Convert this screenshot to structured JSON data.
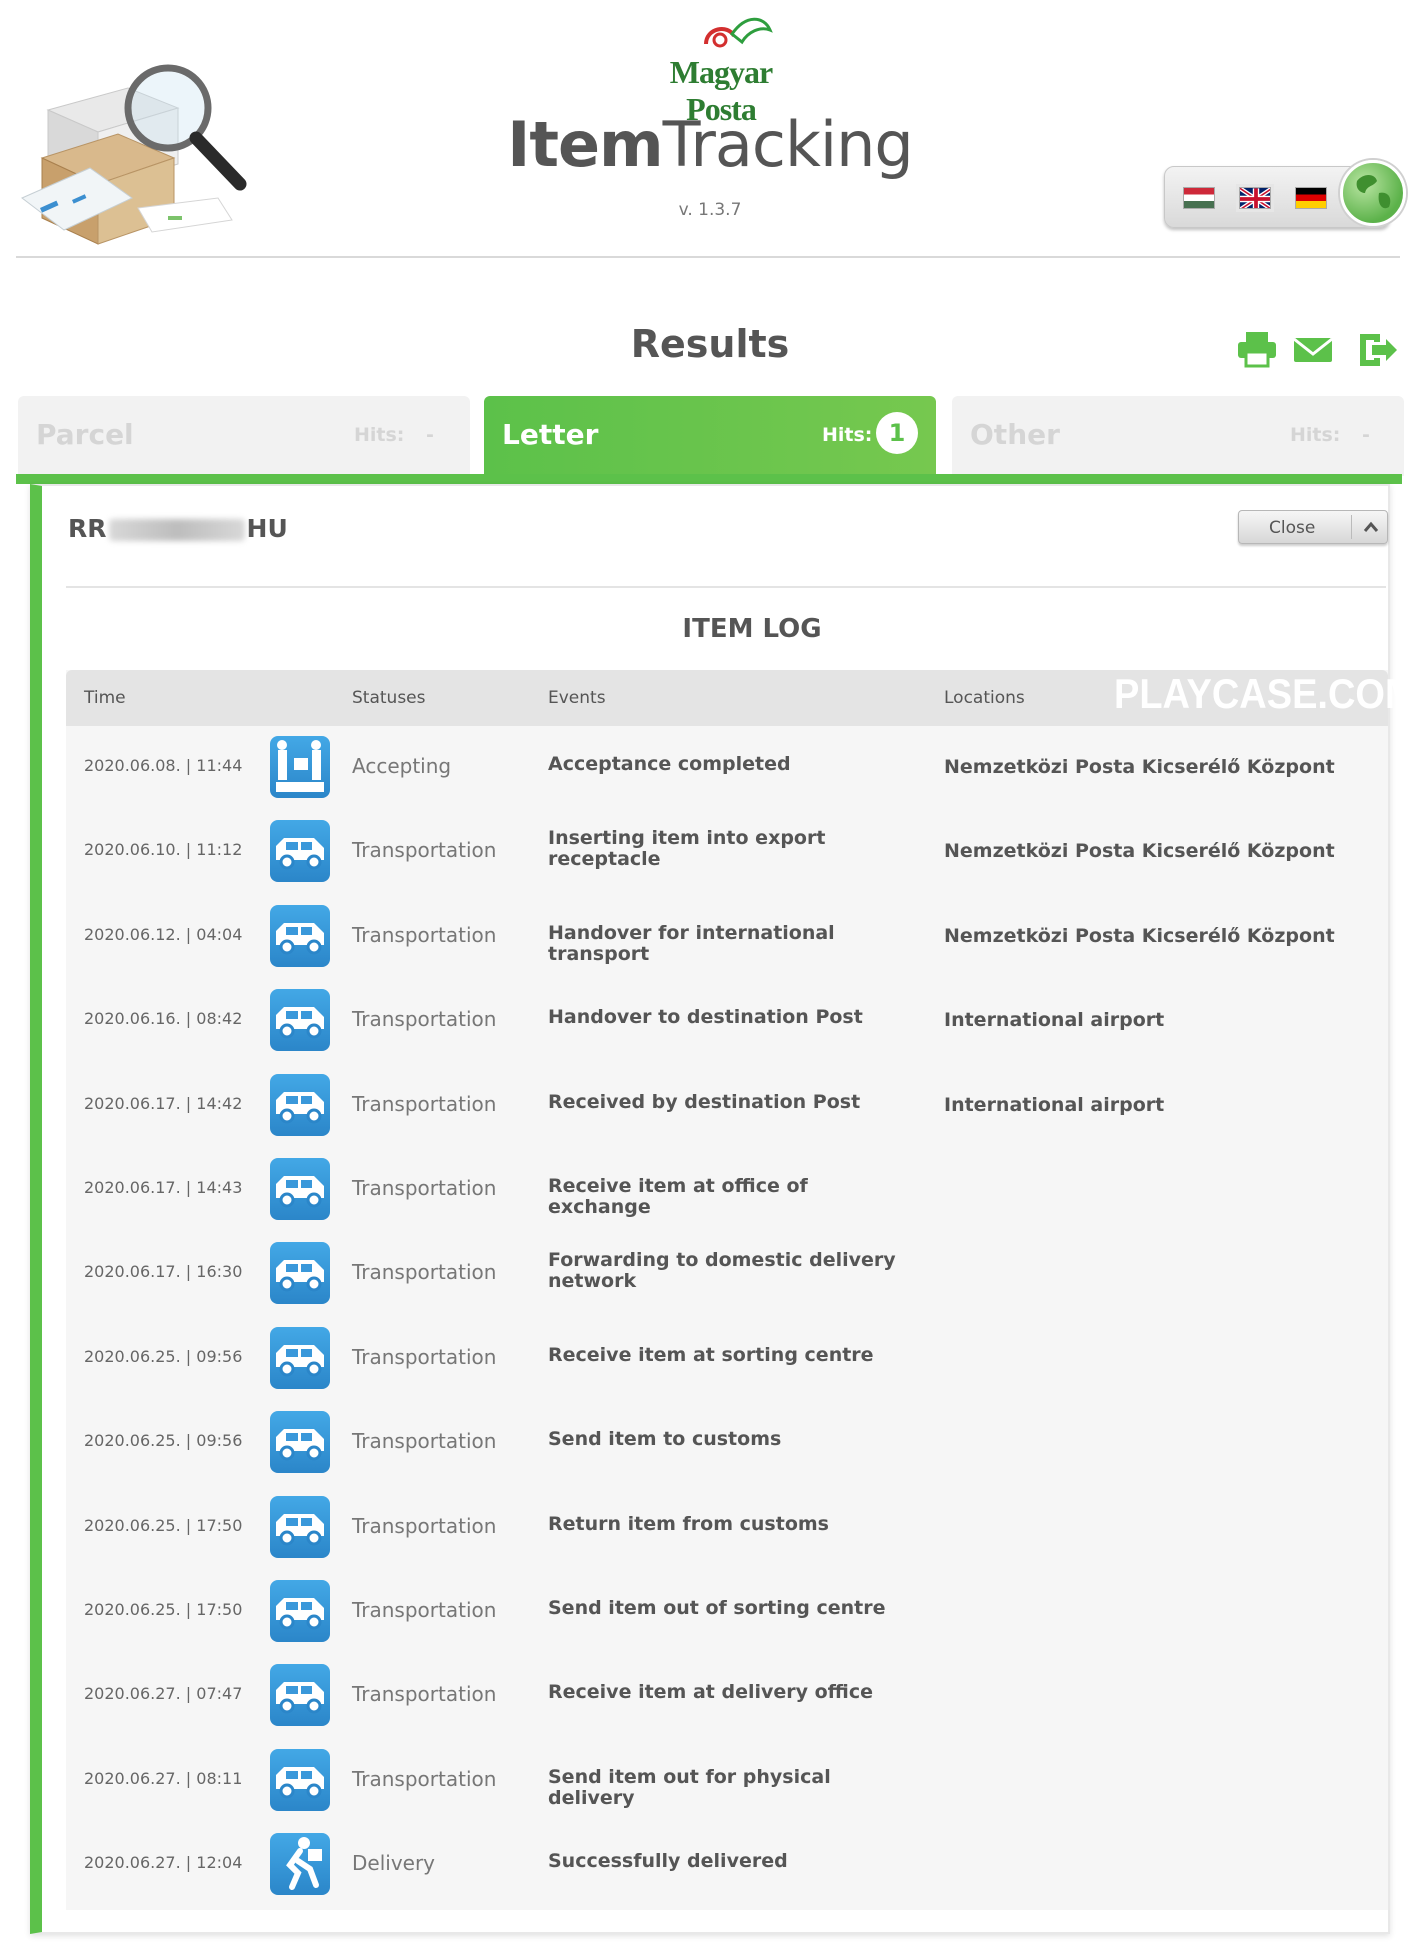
{
  "header": {
    "logo_text": "Magyar Posta",
    "title_bold": "Item",
    "title_light": "Tracking",
    "version": "v. 1.3.7",
    "languages": [
      "hungarian-flag",
      "english-flag",
      "german-flag"
    ],
    "selected_language": "english-flag"
  },
  "results": {
    "title": "Results",
    "actions": [
      "print-icon",
      "email-icon",
      "export-icon"
    ]
  },
  "tabs": [
    {
      "label": "Parcel",
      "hits_label": "Hits:",
      "hits": "-",
      "active": false
    },
    {
      "label": "Letter",
      "hits_label": "Hits:",
      "hits": "1",
      "active": true
    },
    {
      "label": "Other",
      "hits_label": "Hits:",
      "hits": "-",
      "active": false
    }
  ],
  "item": {
    "id_prefix": "RR",
    "id_suffix": "HU",
    "close_label": "Close"
  },
  "log": {
    "title": "ITEM LOG",
    "columns": {
      "time": "Time",
      "statuses": "Statuses",
      "events": "Events",
      "locations": "Locations"
    },
    "watermark": "PLAYCASE.COM",
    "rows": [
      {
        "time": "2020.06.08.  |  11:44",
        "icon": "accepting-icon",
        "status": "Accepting",
        "event": "Acceptance completed",
        "location": "Nemzetközi Posta Kicserélő Központ"
      },
      {
        "time": "2020.06.10.  |  11:12",
        "icon": "van-icon",
        "status": "Transportation",
        "event": "Inserting item into export receptacle",
        "location": "Nemzetközi Posta Kicserélő Központ"
      },
      {
        "time": "2020.06.12.  |  04:04",
        "icon": "van-icon",
        "status": "Transportation",
        "event": "Handover for international transport",
        "location": "Nemzetközi Posta Kicserélő Központ"
      },
      {
        "time": "2020.06.16.  |  08:42",
        "icon": "van-icon",
        "status": "Transportation",
        "event": "Handover to destination Post",
        "location": "International airport"
      },
      {
        "time": "2020.06.17.  |  14:42",
        "icon": "van-icon",
        "status": "Transportation",
        "event": "Received by destination Post",
        "location": "International airport"
      },
      {
        "time": "2020.06.17.  |  14:43",
        "icon": "van-icon",
        "status": "Transportation",
        "event": "Receive item at office of exchange",
        "location": ""
      },
      {
        "time": "2020.06.17.  |  16:30",
        "icon": "van-icon",
        "status": "Transportation",
        "event": "Forwarding to domestic delivery network",
        "location": ""
      },
      {
        "time": "2020.06.25.  |  09:56",
        "icon": "van-icon",
        "status": "Transportation",
        "event": "Receive item at sorting centre",
        "location": ""
      },
      {
        "time": "2020.06.25.  |  09:56",
        "icon": "van-icon",
        "status": "Transportation",
        "event": "Send item to customs",
        "location": ""
      },
      {
        "time": "2020.06.25.  |  17:50",
        "icon": "van-icon",
        "status": "Transportation",
        "event": "Return item from customs",
        "location": ""
      },
      {
        "time": "2020.06.25.  |  17:50",
        "icon": "van-icon",
        "status": "Transportation",
        "event": "Send item out of sorting centre",
        "location": ""
      },
      {
        "time": "2020.06.27.  |  07:47",
        "icon": "van-icon",
        "status": "Transportation",
        "event": "Receive item at delivery office",
        "location": ""
      },
      {
        "time": "2020.06.27.  |  08:11",
        "icon": "van-icon",
        "status": "Transportation",
        "event": "Send item out for physical delivery",
        "location": ""
      },
      {
        "time": "2020.06.27.  |  12:04",
        "icon": "courier-icon",
        "status": "Delivery",
        "event": "Successfully delivered",
        "location": ""
      }
    ]
  },
  "colors": {
    "accent_green": "#5cc14a",
    "status_icon_blue": "#2b86c9"
  }
}
